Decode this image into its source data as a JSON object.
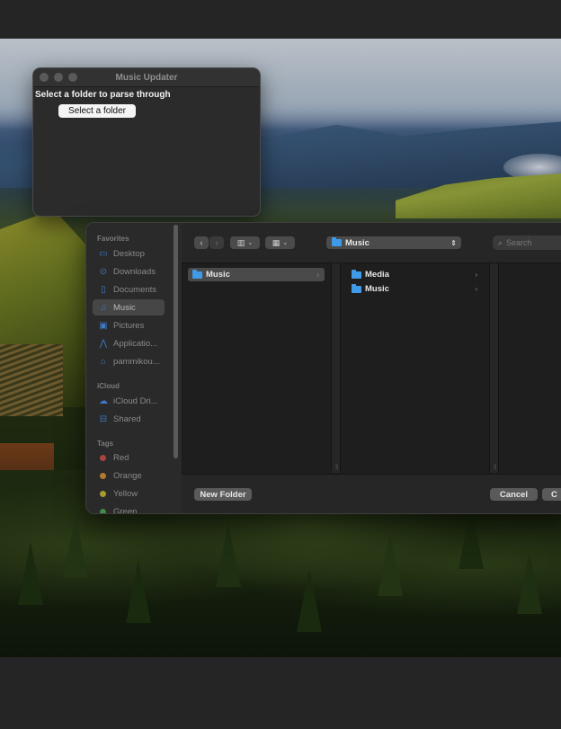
{
  "app_window": {
    "title": "Music Updater",
    "prompt": "Select a folder to parse through",
    "button_label": "Select a folder"
  },
  "open_panel": {
    "sidebar": {
      "favorites_header": "Favorites",
      "favorites": [
        {
          "label": "Desktop",
          "icon": "desktop-icon"
        },
        {
          "label": "Downloads",
          "icon": "downloads-icon"
        },
        {
          "label": "Documents",
          "icon": "documents-icon"
        },
        {
          "label": "Music",
          "icon": "music-note-icon",
          "selected": true
        },
        {
          "label": "Pictures",
          "icon": "pictures-icon"
        },
        {
          "label": "Applicatio...",
          "icon": "applications-icon"
        },
        {
          "label": "pammikou...",
          "icon": "home-icon"
        }
      ],
      "icloud_header": "iCloud",
      "icloud": [
        {
          "label": "iCloud Dri...",
          "icon": "cloud-icon"
        },
        {
          "label": "Shared",
          "icon": "shared-folder-icon"
        }
      ],
      "tags_header": "Tags",
      "tags": [
        {
          "label": "Red",
          "color": "#d2554f"
        },
        {
          "label": "Orange",
          "color": "#e49a35"
        },
        {
          "label": "Yellow",
          "color": "#d9c33a"
        },
        {
          "label": "Green",
          "color": "#4fb059"
        }
      ]
    },
    "toolbar": {
      "location": "Music",
      "search_placeholder": "Search"
    },
    "columns": {
      "first": [
        {
          "label": "Music",
          "selected": true
        }
      ],
      "second": [
        {
          "label": "Media"
        },
        {
          "label": "Music"
        }
      ]
    },
    "buttons": {
      "new_folder": "New Folder",
      "cancel": "Cancel",
      "open_clipped": "C"
    }
  }
}
